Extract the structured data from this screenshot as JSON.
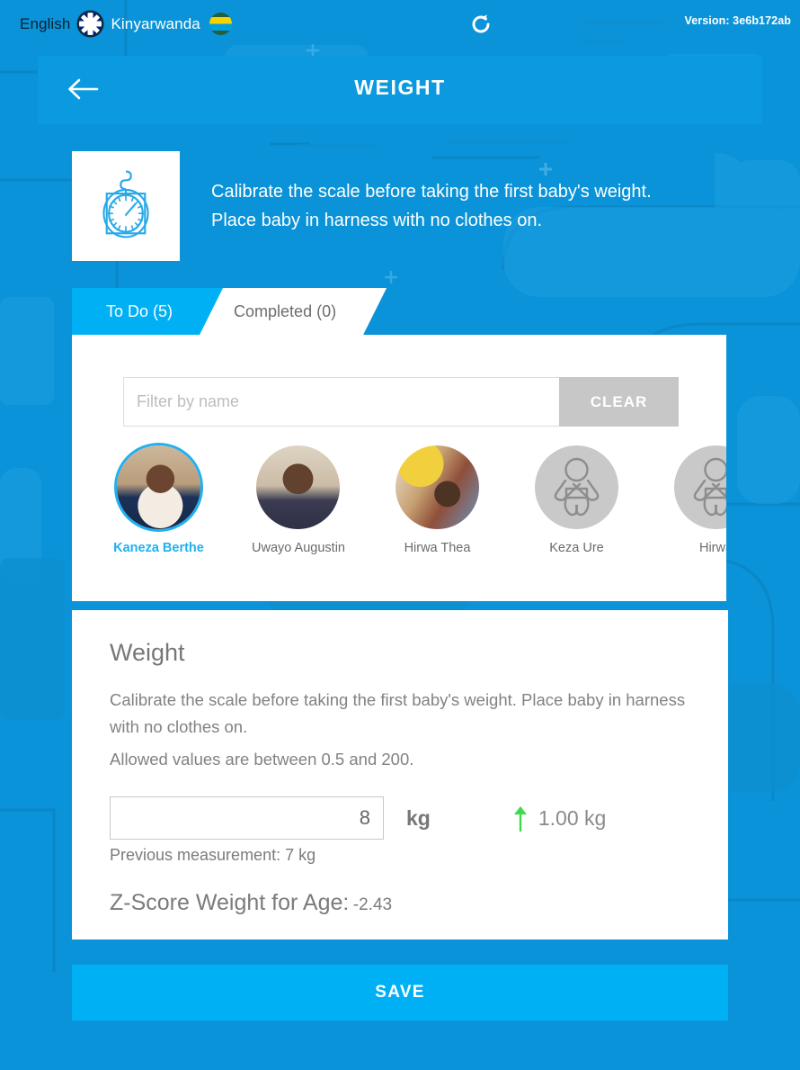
{
  "topbar": {
    "lang_inactive": "English",
    "lang_active": "Kinyarwanda",
    "flag_inactive_name": "uk-flag-icon",
    "flag_active_name": "rwanda-flag-icon",
    "refresh_icon": "refresh-icon",
    "version": "Version: 3e6b172ab"
  },
  "header": {
    "title": "WEIGHT",
    "back_icon": "back-arrow-icon"
  },
  "instruction": {
    "icon": "hanging-scale-icon",
    "line1": "Calibrate the scale before taking the first baby's weight.",
    "line2": "Place baby in harness with no clothes on."
  },
  "tabs": [
    {
      "label": "To Do (5)",
      "active": true
    },
    {
      "label": "Completed (0)",
      "active": false
    }
  ],
  "filter": {
    "value": "",
    "placeholder": "Filter by name",
    "clear_label": "CLEAR"
  },
  "patients": [
    {
      "name": "Kaneza Berthe",
      "selected": true,
      "avatar": "photo-a"
    },
    {
      "name": "Uwayo Augustin",
      "selected": false,
      "avatar": "photo-b"
    },
    {
      "name": "Hirwa Thea",
      "selected": false,
      "avatar": "photo-c"
    },
    {
      "name": "Keza Ure",
      "selected": false,
      "avatar": "placeholder"
    },
    {
      "name": "Hirwa",
      "selected": false,
      "avatar": "placeholder"
    }
  ],
  "form": {
    "title": "Weight",
    "description": "Calibrate the scale before taking the first baby's weight. Place baby in harness with no clothes on.",
    "allowed_values": "Allowed values are between 0.5 and 200.",
    "weight_value": "8",
    "weight_placeholder": "",
    "unit": "kg",
    "delta_icon": "up-arrow-icon",
    "delta_value": "1.00 kg",
    "delta_color": "#3ddb4b",
    "previous_measurement": "Previous measurement: 7 kg",
    "zscore_label": "Z-Score Weight for Age:",
    "zscore_value": "-2.43"
  },
  "save": {
    "label": "SAVE"
  },
  "colors": {
    "background_blue": "#0a93d8",
    "header_blue": "#0b9ae0",
    "accent_blue": "#00b0f5",
    "selected_blue": "#21b0f0"
  }
}
